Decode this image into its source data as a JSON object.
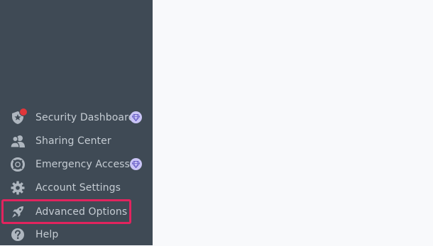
{
  "sidebar": {
    "items": [
      {
        "label": "Security Dashboard",
        "icon": "shield-icon",
        "premium": true,
        "notification": true
      },
      {
        "label": "Sharing Center",
        "icon": "people-icon",
        "premium": false
      },
      {
        "label": "Emergency Access",
        "icon": "lifebuoy-icon",
        "premium": true
      },
      {
        "label": "Account Settings",
        "icon": "gear-icon",
        "premium": false
      },
      {
        "label": "Advanced Options",
        "icon": "rocket-icon",
        "premium": false,
        "highlighted": true
      },
      {
        "label": "Help",
        "icon": "question-icon",
        "premium": false
      }
    ]
  },
  "colors": {
    "sidebar_bg": "#3f4a55",
    "main_bg": "#f8f9fb",
    "label": "#c5ccd3",
    "highlight": "#e2245e",
    "premium_badge": "#c9c4f5",
    "notification": "#e0363a"
  }
}
